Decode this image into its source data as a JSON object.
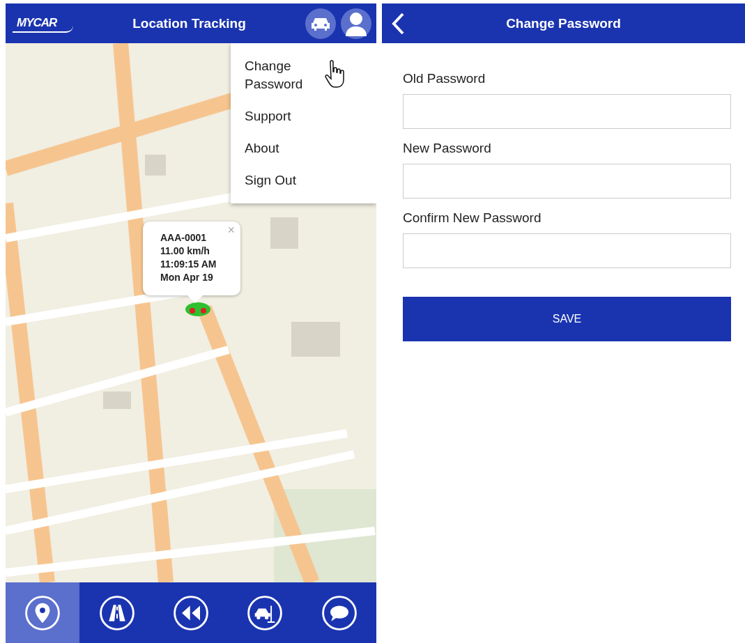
{
  "tracking_screen": {
    "logo": "MYCAR",
    "title": "Location Tracking",
    "menu": {
      "items": [
        {
          "label": "Change Password",
          "hovered": true
        },
        {
          "label": "Support",
          "hovered": false
        },
        {
          "label": "About",
          "hovered": false
        },
        {
          "label": "Sign Out",
          "hovered": false
        }
      ]
    },
    "info_popup": {
      "close": "×",
      "lines": [
        "AAA-0001",
        "11.00 km/h",
        "11:09:15 AM",
        "Mon Apr 19"
      ]
    },
    "nav": [
      {
        "kind": "location",
        "selected": true
      },
      {
        "kind": "road",
        "selected": false
      },
      {
        "kind": "rewind",
        "selected": false
      },
      {
        "kind": "service",
        "selected": false
      },
      {
        "kind": "chat",
        "selected": false
      }
    ]
  },
  "password_screen": {
    "title": "Change Password",
    "fields": [
      {
        "label": "Old Password"
      },
      {
        "label": "New Password"
      },
      {
        "label": "Confirm New Password"
      }
    ],
    "save": "SAVE"
  }
}
